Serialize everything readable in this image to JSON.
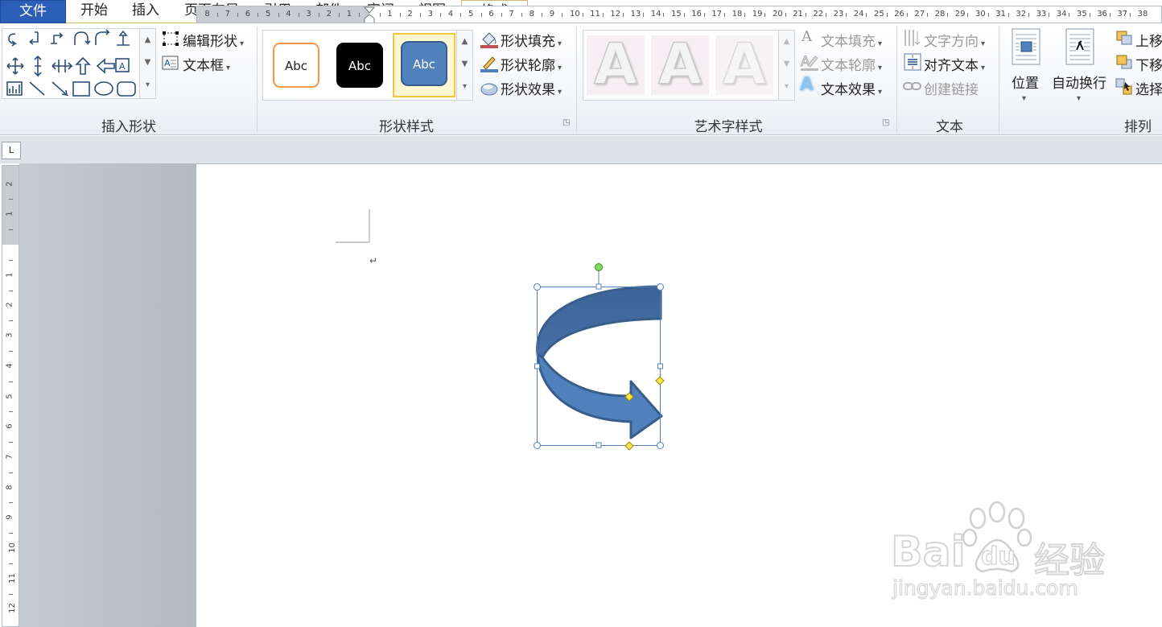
{
  "tabs": {
    "file": "文件",
    "home": "开始",
    "insert": "插入",
    "layout": "页面布局",
    "references": "引用",
    "mailings": "邮件",
    "review": "审阅",
    "view": "视图",
    "format": "格式"
  },
  "insert_shapes": {
    "edit_shape": "编辑形状",
    "text_box": "文本框",
    "label": "插入形状"
  },
  "shape_styles": {
    "swatch_1": "Abc",
    "swatch_2": "Abc",
    "swatch_3": "Abc",
    "fill": "形状填充",
    "outline": "形状轮廓",
    "effects": "形状效果",
    "label": "形状样式"
  },
  "wordart_styles": {
    "sample_1": "A",
    "sample_2": "A",
    "sample_3": "A",
    "text_fill": "文本填充",
    "text_outline": "文本轮廓",
    "text_effects": "文本效果",
    "label": "艺术字样式"
  },
  "text_group": {
    "direction": "文字方向",
    "align": "对齐文本",
    "create_link": "创建链接",
    "label": "文本"
  },
  "arrange": {
    "position": "位置",
    "wrap": "自动换行",
    "bring_forward": "上移",
    "send_backward": "下移",
    "selection": "选择",
    "label": "排列"
  },
  "ruler": {
    "corner": "L",
    "h_left_numbers": [
      "8",
      "7",
      "6",
      "5",
      "4",
      "3",
      "2",
      "1"
    ],
    "h_right_numbers": [
      "1",
      "2",
      "3",
      "4",
      "5",
      "6",
      "7",
      "8",
      "9",
      "10",
      "11",
      "12",
      "13",
      "14",
      "15",
      "16",
      "17",
      "18",
      "19",
      "20",
      "21",
      "22",
      "23",
      "24",
      "25",
      "26",
      "27",
      "28",
      "29",
      "30",
      "31",
      "32",
      "33",
      "34",
      "35",
      "36",
      "37",
      "38"
    ],
    "v_top_numbers": [
      "2",
      "1"
    ],
    "v_numbers": [
      "1",
      "2",
      "3",
      "4",
      "5",
      "6",
      "7",
      "8",
      "9",
      "10",
      "11",
      "12"
    ]
  },
  "document": {
    "paragraph_mark": "↵"
  },
  "watermark": {
    "brand": "Bai",
    "brand2": "du",
    "product": "经验",
    "url": "jingyan.baidu.com"
  },
  "colors": {
    "file_tab": "#2b5fb7",
    "arrow_fill": "#4f81bd",
    "arrow_outline": "#385d8a",
    "selection": "#4f81bd"
  }
}
